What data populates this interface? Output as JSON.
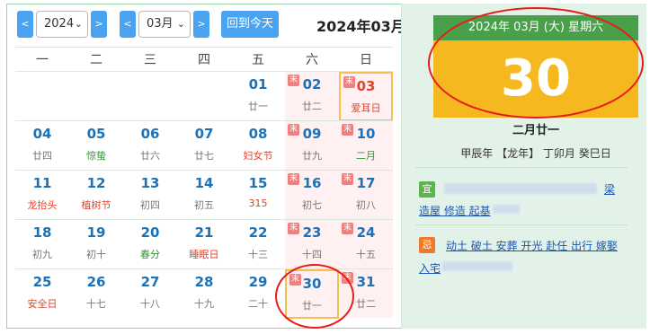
{
  "toolbar": {
    "prev_year": "<",
    "next_year": ">",
    "year_value": "2024",
    "prev_month": "<",
    "next_month": ">",
    "month_value": "03月",
    "today_label": "回到今天",
    "title": "2024年03月"
  },
  "weekdays": [
    "一",
    "二",
    "三",
    "四",
    "五",
    "六",
    "日"
  ],
  "weeks": [
    [
      null,
      null,
      null,
      null,
      {
        "day": "01",
        "sub": "廿一"
      },
      {
        "day": "02",
        "sub": "廿二",
        "tag": "末"
      },
      {
        "day": "03",
        "sub": "爱耳日",
        "tag": "末",
        "red_num": true,
        "red_sub": true
      }
    ],
    [
      {
        "day": "04",
        "sub": "廿四"
      },
      {
        "day": "05",
        "sub": "惊蛰",
        "green_sub": true
      },
      {
        "day": "06",
        "sub": "廿六"
      },
      {
        "day": "07",
        "sub": "廿七"
      },
      {
        "day": "08",
        "sub": "妇女节",
        "red_sub": true
      },
      {
        "day": "09",
        "sub": "廿九",
        "tag": "末"
      },
      {
        "day": "10",
        "sub": "二月",
        "tag": "末",
        "green_sub": true
      }
    ],
    [
      {
        "day": "11",
        "sub": "龙抬头",
        "red_sub": true
      },
      {
        "day": "12",
        "sub": "植树节",
        "red_sub": true
      },
      {
        "day": "13",
        "sub": "初四"
      },
      {
        "day": "14",
        "sub": "初五"
      },
      {
        "day": "15",
        "sub": "315",
        "red_sub": true
      },
      {
        "day": "16",
        "sub": "初七",
        "tag": "末"
      },
      {
        "day": "17",
        "sub": "初八",
        "tag": "末"
      }
    ],
    [
      {
        "day": "18",
        "sub": "初九"
      },
      {
        "day": "19",
        "sub": "初十"
      },
      {
        "day": "20",
        "sub": "春分",
        "green_sub": true
      },
      {
        "day": "21",
        "sub": "睡眠日",
        "red_sub": true
      },
      {
        "day": "22",
        "sub": "十三"
      },
      {
        "day": "23",
        "sub": "十四",
        "tag": "末"
      },
      {
        "day": "24",
        "sub": "十五",
        "tag": "末"
      }
    ],
    [
      {
        "day": "25",
        "sub": "安全日",
        "red_sub": true
      },
      {
        "day": "26",
        "sub": "十七"
      },
      {
        "day": "27",
        "sub": "十八"
      },
      {
        "day": "28",
        "sub": "十九"
      },
      {
        "day": "29",
        "sub": "二十"
      },
      {
        "day": "30",
        "sub": "廿一",
        "tag": "末",
        "selected": true
      },
      {
        "day": "31",
        "sub": "廿二",
        "tag": "末"
      }
    ]
  ],
  "detail": {
    "header": "2024年 03月 (大) 星期六",
    "big_day": "30",
    "lunar": "二月廿一",
    "ganzhi": "甲辰年 【龙年】 丁卯月 癸巳日",
    "yi_badge": "宜",
    "yi_line1": "梁",
    "yi_line2": "造屋 修造 起基",
    "ji_badge": "忌",
    "ji_line1": "动土 破土 安葬 开光 赴任 出行 嫁娶",
    "ji_line2": "入宅"
  },
  "colors": {
    "accent_blue": "#4aa3f0",
    "header_green": "#4aa04a",
    "big_yellow": "#f5b81f",
    "annotation_red": "#e81b1b",
    "weekend_pink": "#fff1f1"
  }
}
